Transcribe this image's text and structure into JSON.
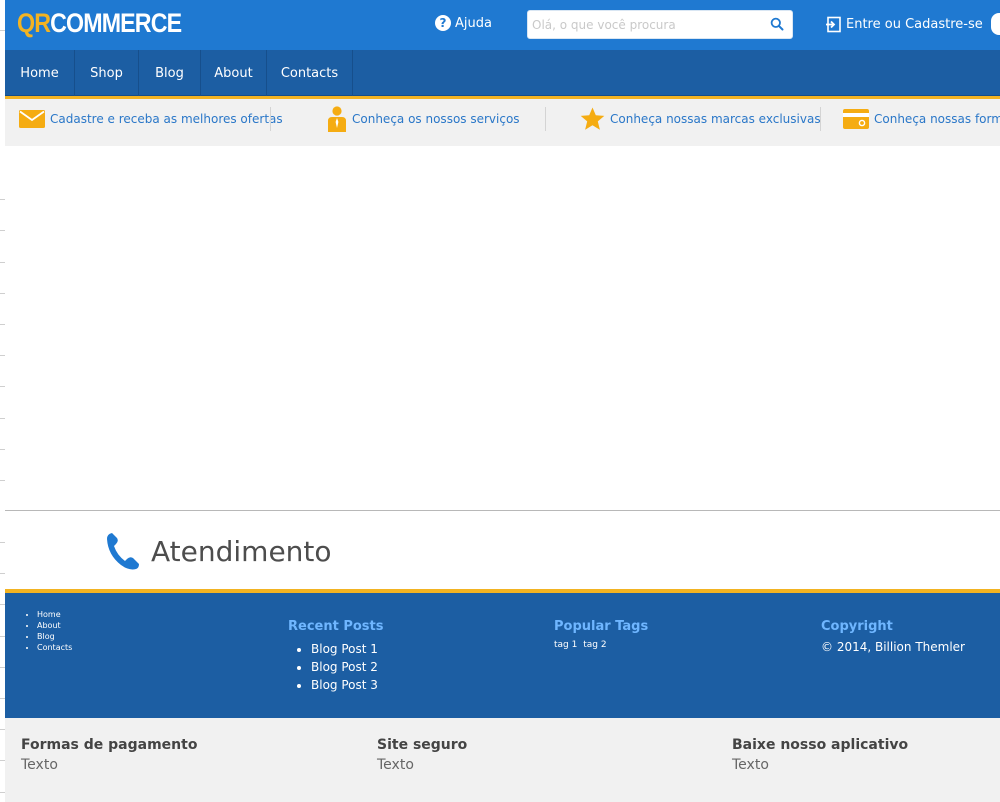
{
  "header": {
    "logo_qr": "QR",
    "logo_commerce": "COMMERCE",
    "help_label": "Ajuda",
    "search_placeholder": "Olá, o que você procura",
    "login_label": "Entre ou Cadastre-se"
  },
  "nav": {
    "items": [
      {
        "label": "Home"
      },
      {
        "label": "Shop"
      },
      {
        "label": "Blog"
      },
      {
        "label": "About"
      },
      {
        "label": "Contacts"
      }
    ]
  },
  "infobar": {
    "items": [
      {
        "label": "Cadastre e receba as melhores ofertas",
        "icon": "envelope-icon"
      },
      {
        "label": "Conheça os nossos serviços",
        "icon": "person-icon"
      },
      {
        "label": "Conheça nossas marcas exclusivas",
        "icon": "star-icon"
      },
      {
        "label": "Conheça nossas forma",
        "icon": "credit-card-icon"
      }
    ]
  },
  "atendimento": {
    "label": "Atendimento",
    "icon": "phone-icon"
  },
  "footer": {
    "menu": [
      "Home",
      "About",
      "Blog",
      "Contacts"
    ],
    "recent_posts": {
      "title": "Recent Posts",
      "items": [
        "Blog Post 1",
        "Blog Post 2",
        "Blog Post 3"
      ]
    },
    "popular_tags": {
      "title": "Popular Tags",
      "items": [
        "tag 1",
        "tag 2"
      ]
    },
    "copyright": {
      "title": "Copyright",
      "text": "© 2014, Billion Themler"
    }
  },
  "bottom": {
    "columns": [
      {
        "title": "Formas de pagamento",
        "text": "Texto"
      },
      {
        "title": "Site seguro",
        "text": "Texto"
      },
      {
        "title": "Baixe nosso aplicativo",
        "text": "Texto"
      }
    ]
  },
  "colors": {
    "header_blue": "#1f79d1",
    "nav_blue": "#1c5ea3",
    "accent_yellow": "#f2b322",
    "link_blue": "#2a77c8",
    "footer_heading": "#6fb6ff",
    "strip_gray": "#f1f1f1"
  }
}
